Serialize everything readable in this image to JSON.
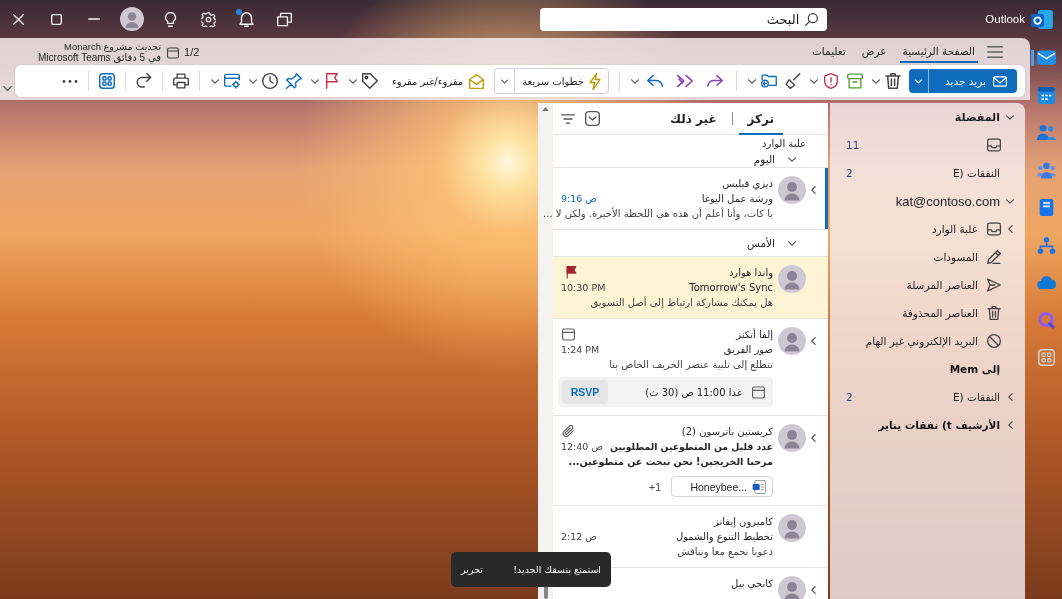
{
  "title_bar": {
    "app_name": "Outlook",
    "search": {
      "placeholder": "البحث"
    },
    "notifications_unread": true
  },
  "app_rail": [
    {
      "selected": true
    },
    {
      "selected": false
    },
    {
      "selected": false
    },
    {
      "selected": false
    },
    {
      "selected": false
    },
    {
      "selected": false
    },
    {
      "selected": false
    },
    {
      "selected": false
    },
    {
      "selected": false
    }
  ],
  "ribbon": {
    "tabs": [
      {
        "label": "الصفحة الرئيسية",
        "selected": true
      },
      {
        "label": "عرض",
        "selected": false
      },
      {
        "label": "تعليمات",
        "selected": false
      }
    ],
    "reminder": {
      "count": "1/2",
      "title": "تحديث مشروع Monarch",
      "detail": "في 5 دقائق Microsoft Teams"
    },
    "toolbar": {
      "new_mail": "بريد جديد",
      "quick_steps": "خطوات سريعة",
      "read_unread": "مقروء/غير مقروء"
    }
  },
  "folder_pane": {
    "sections": [
      {
        "kind": "favorites",
        "label": "المفضلة",
        "expanded": true,
        "children": [
          {
            "kind": "inbox",
            "count": "11"
          },
          {
            "kind": "plain",
            "label": "E) النفقات",
            "count": "2",
            "unread": false
          }
        ]
      },
      {
        "kind": "account",
        "label": "kat@contoso.com",
        "expanded": true,
        "children": [
          {
            "kind": "inbox",
            "label": "علبة الوارد",
            "expanded": false,
            "unread": false
          },
          {
            "kind": "drafts",
            "label": "المسودات",
            "unread": false
          },
          {
            "kind": "sent",
            "label": "العناصر المرسلة",
            "unread": false
          },
          {
            "kind": "deleted",
            "label": "العناصر المحذوفة",
            "unread": false
          },
          {
            "kind": "junk",
            "label": "البريد الإلكتروني غير الهام",
            "unread": false
          },
          {
            "kind": "plain",
            "label": "Mem إلى",
            "unread": true
          },
          {
            "kind": "plain",
            "label": "E) النفقات",
            "expanded": false,
            "count": "2",
            "unread": false
          },
          {
            "kind": "plain",
            "label": "الأرشيف t) نفقات يناير",
            "expanded": false,
            "unread": true
          }
        ]
      }
    ]
  },
  "message_list": {
    "tabs": [
      {
        "label": "تركز",
        "selected": true
      },
      {
        "label": "غير ذلك",
        "selected": false
      }
    ],
    "folder_title": "علبة الوارد",
    "groups": [
      {
        "label": "اليوم",
        "expanded": true,
        "messages": [
          {
            "sender": "ديزي فيلبس",
            "subject": "ورشة عمل اليوغا",
            "time": "9:16 ص",
            "preview": "يا كات، وأنا أعلم أن هذه هي اللحظة الأخيرة. ولكن لا ...",
            "selected": true,
            "unread": false,
            "flagged": false,
            "thread": true
          }
        ]
      },
      {
        "label": "الأمس",
        "expanded": true,
        "messages": [
          {
            "sender": "واندا هوارد",
            "subject": "Tomorrow's Sync",
            "time": "10:30 PM",
            "preview": "هل يمكنك مشاركة ارتباط إلى أصل التسويق",
            "selected": false,
            "unread": false,
            "flagged": true,
            "thread": false
          },
          {
            "sender": "إلفا أتكنز",
            "subject": "صور الفريق",
            "time": "1:24 PM",
            "preview": "تتطلع إلى تلبية عنصر الخريف الخاص بنا",
            "selected": false,
            "unread": false,
            "flagged": false,
            "thread": true,
            "invite": {
              "when": "غدا 11:00 ص (30 ث)",
              "action": "RSVP"
            }
          },
          {
            "sender": "كريستين باترسون (2)",
            "subject": "عدد قليل من المتطوعين المطلوبين",
            "time": "12:40 ص",
            "preview": "مرحبا الخريجين! نحن نبحث عن متطوعين...",
            "selected": false,
            "unread": true,
            "flagged": false,
            "thread": true,
            "attachment": {
              "name": "Honeybee...",
              "more": "+1"
            }
          },
          {
            "sender": "كاميرون إيفانز",
            "subject": "تخطيط التنوع والشمول",
            "time": "2:12 ص",
            "preview": "دعونا نجمع معا ونناقش",
            "selected": false,
            "unread": false,
            "flagged": false,
            "thread": false
          },
          {
            "sender": "كانجي بيل",
            "selected": false,
            "unread": false,
            "flagged": false,
            "thread": true
          }
        ]
      }
    ]
  },
  "toast": {
    "message": "استمتع بنسقك الجديد!",
    "action": "تحرير"
  }
}
